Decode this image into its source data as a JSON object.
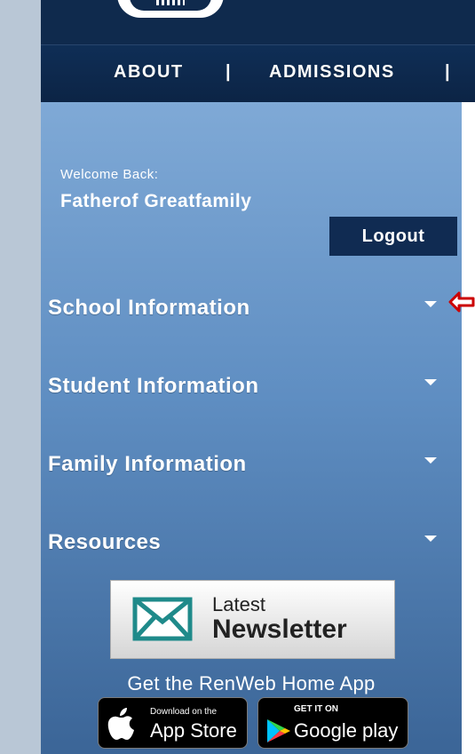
{
  "nav": {
    "about": "ABOUT",
    "separator": "|",
    "admissions": "ADMISSIONS"
  },
  "user": {
    "welcome_label": "Welcome Back:",
    "name": "Fatherof Greatfamily",
    "logout_label": "Logout"
  },
  "menu": {
    "items": [
      {
        "label": "School Information",
        "icon": "caret-down-icon"
      },
      {
        "label": "Student Information",
        "icon": "caret-down-icon"
      },
      {
        "label": "Family Information",
        "icon": "caret-down-icon"
      },
      {
        "label": "Resources",
        "icon": "caret-down-icon"
      }
    ]
  },
  "newsletter": {
    "line1": "Latest",
    "line2": "Newsletter",
    "icon": "envelope-icon"
  },
  "app_promo": {
    "heading": "Get the RenWeb Home App",
    "app_store": {
      "small": "Download on the",
      "big": "App Store",
      "icon": "apple-icon"
    },
    "google_play": {
      "small": "GET IT ON",
      "big": "Google play",
      "icon": "play-triangle-icon"
    }
  },
  "colors": {
    "header_navy": "#0f2a4d",
    "sidebar_top": "#7fa9d6",
    "sidebar_bottom": "#3b6597",
    "logout_bg": "#102b52",
    "annotation_red": "#cc0000",
    "newsletter_teal": "#1f8a8a"
  }
}
